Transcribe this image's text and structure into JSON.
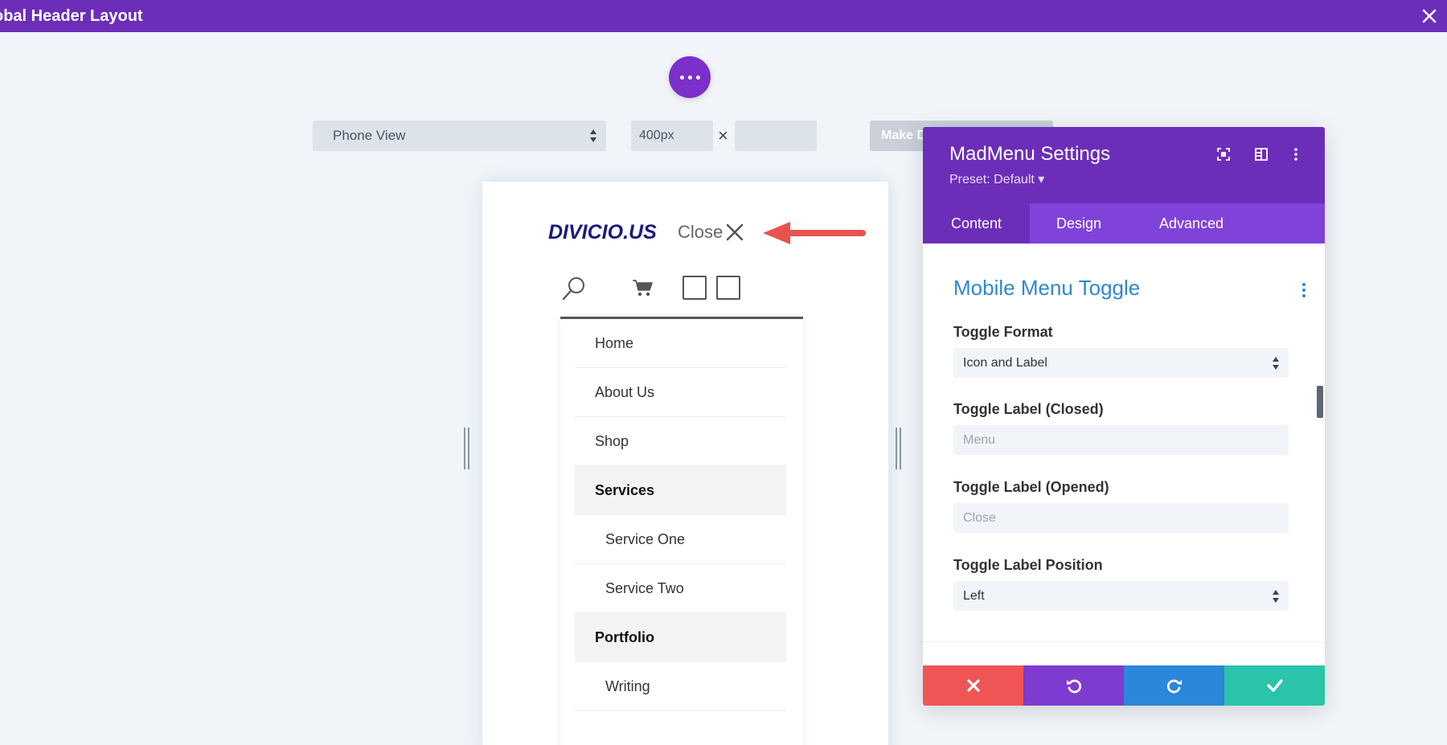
{
  "topbar": {
    "title": "obal Header Layout"
  },
  "toolbar": {
    "view_select": "Phone View",
    "width_value": "400px",
    "times_sign": "×",
    "height_value": "",
    "make_button": "Make Default"
  },
  "preview": {
    "logo_text": "DIVICIO.US",
    "toggle_label": "Close",
    "menu_items": [
      {
        "label": "Home",
        "style": "normal"
      },
      {
        "label": "About Us",
        "style": "normal"
      },
      {
        "label": "Shop",
        "style": "normal"
      },
      {
        "label": "Services",
        "style": "parent"
      },
      {
        "label": "Service One",
        "style": "child"
      },
      {
        "label": "Service Two",
        "style": "child"
      },
      {
        "label": "Portfolio",
        "style": "parent"
      },
      {
        "label": "Writing",
        "style": "child"
      }
    ]
  },
  "panel": {
    "title": "MadMenu Settings",
    "preset": "Preset: Default ▾",
    "tabs": [
      {
        "label": "Content",
        "active": true
      },
      {
        "label": "Design",
        "active": false
      },
      {
        "label": "Advanced",
        "active": false
      }
    ],
    "section_title": "Mobile Menu Toggle",
    "fields": {
      "toggle_format": {
        "label": "Toggle Format",
        "value": "Icon and Label"
      },
      "label_closed": {
        "label": "Toggle Label (Closed)",
        "placeholder": "Menu"
      },
      "label_opened": {
        "label": "Toggle Label (Opened)",
        "placeholder": "Close"
      },
      "label_position": {
        "label": "Toggle Label Position",
        "value": "Left"
      }
    }
  },
  "colors": {
    "topbar": "#6c2eb9",
    "tabs": "#8142da",
    "accent_blue": "#2e88ce",
    "cancel": "#ef5555",
    "undo": "#7e3bd0",
    "redo": "#2b87da",
    "save": "#29c4a9",
    "arrow": "#e8534f",
    "logo": "#1a1a7e"
  },
  "icons": {
    "topbar_close": "close-icon",
    "fab": "more-horizontal-icon",
    "panel_header": [
      "fullscreen-icon",
      "split-view-icon",
      "kebab-menu-icon"
    ],
    "footer": [
      "cancel-icon",
      "undo-icon",
      "redo-icon",
      "save-check-icon"
    ]
  }
}
